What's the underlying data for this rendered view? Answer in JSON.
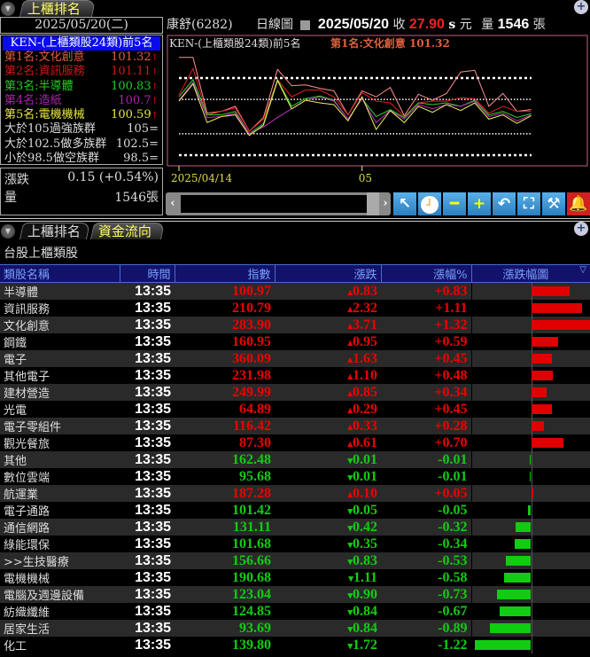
{
  "top_tab": "上櫃排名",
  "left": {
    "date": "2025/05/20(二)",
    "title": "KEN-(上櫃類股24類)前5名",
    "items": [
      {
        "label": "第1名:文化創意",
        "value": "101.32",
        "mark": "↑",
        "color": "#e0603a"
      },
      {
        "label": "第2名:資訊服務",
        "value": "101.11",
        "mark": "↑",
        "color": "#d01818"
      },
      {
        "label": "第3名:半導體",
        "value": "100.83",
        "mark": "↑",
        "color": "#22cc22"
      },
      {
        "label": "第4名:造紙",
        "value": "100.7",
        "mark": "↑",
        "color": "#b020b0"
      },
      {
        "label": "第5名:電機機械",
        "value": "100.59",
        "mark": "↑",
        "color": "#e8e840"
      },
      {
        "label": "大於105過強族群",
        "value": "105",
        "mark": "=",
        "color": "#dddddd"
      },
      {
        "label": "大於102.5做多族群",
        "value": "102.5",
        "mark": "=",
        "color": "#dddddd"
      },
      {
        "label": "小於98.5做空族群",
        "value": "98.5",
        "mark": "=",
        "color": "#dddddd"
      }
    ],
    "change_label": "漲跌",
    "change_value": "0.15 (+0.54%)",
    "volume_label": "量",
    "volume_value": "1546張"
  },
  "header": {
    "stock": "康舒(6282)",
    "chart_type": "日線圖",
    "date": "2025/05/20",
    "close_label": "收",
    "close": "27.90",
    "s": "s",
    "unit": "元",
    "vol_label": "量",
    "vol": "1546",
    "vol_unit": "張"
  },
  "chart_data": {
    "type": "line",
    "title": "KEN-(上櫃類股24類)前5名",
    "highlight": "第1名:文化創意 101.32",
    "x_ticks": [
      {
        "index": 0,
        "label": "2025/04/14"
      },
      {
        "index": 13,
        "label": "05"
      }
    ],
    "reference_lines": [
      105,
      102.5,
      98.5,
      96
    ],
    "ylim": [
      96,
      105
    ],
    "series": [
      {
        "name": "文化創意",
        "color": "#ff9090",
        "values": [
          107.4,
          107.4,
          100.9,
          101.1,
          101.7,
          98.8,
          100.4,
          106.0,
          104.1,
          104.2,
          103.8,
          103.5,
          100.7,
          103.5,
          102.8,
          103.9,
          100.6,
          103.1,
          102.4,
          103.2,
          105.7,
          105.9,
          101.7,
          103.2,
          101.1,
          101.32
        ]
      },
      {
        "name": "資訊服務",
        "color": "#e02020",
        "values": [
          103.0,
          106.1,
          100.7,
          101.1,
          101.5,
          98.8,
          100.2,
          104.8,
          102.8,
          103.6,
          103.6,
          102.8,
          100.7,
          103.3,
          102.3,
          102.1,
          100.5,
          102.1,
          102.3,
          102.3,
          102.7,
          102.6,
          100.9,
          101.7,
          101.1,
          101.11
        ]
      },
      {
        "name": "半導體",
        "color": "#30d030",
        "values": [
          102.8,
          104.8,
          100.7,
          100.7,
          101.1,
          98.5,
          99.7,
          104.8,
          101.7,
          102.6,
          102.9,
          102.4,
          100.2,
          102.6,
          100.5,
          101.3,
          100.4,
          102.1,
          101.9,
          102.1,
          101.7,
          102.4,
          100.7,
          101.1,
          100.4,
          100.83
        ]
      },
      {
        "name": "造紙",
        "color": "#c030c0",
        "values": [
          102.4,
          104.5,
          100.4,
          100.5,
          100.9,
          98.5,
          99.3,
          100.4,
          101.4,
          102.4,
          102.8,
          102.3,
          100.2,
          102.6,
          99.8,
          101.2,
          100.2,
          101.9,
          101.4,
          101.9,
          101.7,
          102.3,
          100.5,
          100.9,
          100.0,
          100.7
        ]
      },
      {
        "name": "電機機械",
        "color": "#f0f060",
        "values": [
          102.3,
          104.3,
          99.8,
          100.5,
          100.7,
          98.3,
          99.5,
          104.7,
          101.4,
          102.4,
          102.1,
          101.9,
          100.0,
          102.8,
          99.0,
          101.2,
          99.8,
          101.7,
          101.0,
          101.9,
          101.2,
          102.1,
          100.2,
          100.7,
          99.7,
          100.59
        ]
      }
    ]
  },
  "toolbar": [
    "arrow-icon",
    "clock-icon",
    "zoom-out-icon",
    "zoom-in-icon",
    "undo-icon",
    "fit-icon",
    "wrench-icon",
    "bell-icon"
  ],
  "bottom_tabs": [
    "上櫃排名",
    "資金流向"
  ],
  "section_title": "台股上櫃類股",
  "table": {
    "headers": [
      "類股名稱",
      "時間",
      "指數",
      "漲跌",
      "漲幅%",
      "漲跌幅圖"
    ],
    "rows": [
      [
        "半導體",
        "13:35",
        "100.97",
        "0.83",
        "+0.83",
        0.83
      ],
      [
        "資訊服務",
        "13:35",
        "210.79",
        "2.32",
        "+1.11",
        1.11
      ],
      [
        "文化創意",
        "13:35",
        "283.90",
        "3.71",
        "+1.32",
        1.32
      ],
      [
        "鋼鐵",
        "13:35",
        "160.95",
        "0.95",
        "+0.59",
        0.59
      ],
      [
        "電子",
        "13:35",
        "360.09",
        "1.63",
        "+0.45",
        0.45
      ],
      [
        "其他電子",
        "13:35",
        "231.98",
        "1.10",
        "+0.48",
        0.48
      ],
      [
        "建材營造",
        "13:35",
        "249.99",
        "0.85",
        "+0.34",
        0.34
      ],
      [
        "光電",
        "13:35",
        "64.89",
        "0.29",
        "+0.45",
        0.45
      ],
      [
        "電子零組件",
        "13:35",
        "116.42",
        "0.33",
        "+0.28",
        0.28
      ],
      [
        "觀光餐旅",
        "13:35",
        "87.30",
        "0.61",
        "+0.70",
        0.7
      ],
      [
        "其他",
        "13:35",
        "162.48",
        "0.01",
        "-0.01",
        -0.01
      ],
      [
        "數位雲端",
        "13:35",
        "95.68",
        "0.01",
        "-0.01",
        -0.01
      ],
      [
        "航運業",
        "13:35",
        "187.28",
        "0.10",
        "+0.05",
        0.05
      ],
      [
        "電子通路",
        "13:35",
        "101.42",
        "0.05",
        "-0.05",
        -0.05
      ],
      [
        "通信網路",
        "13:35",
        "131.11",
        "0.42",
        "-0.32",
        -0.32
      ],
      [
        "綠能環保",
        "13:35",
        "101.68",
        "0.35",
        "-0.34",
        -0.34
      ],
      [
        ">>生技醫療",
        "13:35",
        "156.66",
        "0.83",
        "-0.53",
        -0.53
      ],
      [
        "電機機械",
        "13:35",
        "190.68",
        "1.11",
        "-0.58",
        -0.58
      ],
      [
        "電腦及週邊設備",
        "13:35",
        "123.04",
        "0.90",
        "-0.73",
        -0.73
      ],
      [
        "紡織纖維",
        "13:35",
        "124.85",
        "0.84",
        "-0.67",
        -0.67
      ],
      [
        "居家生活",
        "13:35",
        "93.69",
        "0.84",
        "-0.89",
        -0.89
      ],
      [
        "化工",
        "13:35",
        "139.80",
        "1.72",
        "-1.22",
        -1.22
      ]
    ]
  },
  "colors": {
    "up": "#e00000",
    "down": "#11cc11"
  }
}
